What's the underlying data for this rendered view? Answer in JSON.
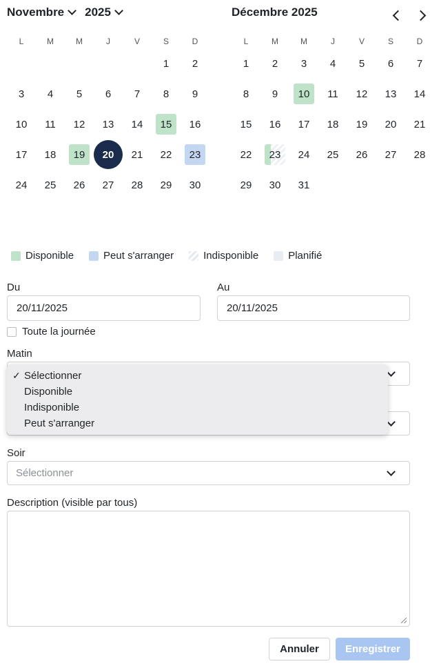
{
  "nav": {
    "left_month": "Novembre",
    "left_year": "2025",
    "right_title": "Décembre 2025"
  },
  "weekdays": [
    "L",
    "M",
    "M",
    "J",
    "V",
    "S",
    "D"
  ],
  "calendars": [
    {
      "name": "novembre",
      "rows": [
        [
          "",
          "",
          "",
          "",
          "",
          "1",
          "2"
        ],
        [
          "3",
          "4",
          "5",
          "6",
          "7",
          "8",
          "9"
        ],
        [
          "10",
          "11",
          "12",
          "13",
          "14",
          "15",
          "16"
        ],
        [
          "17",
          "18",
          "19",
          "20",
          "21",
          "22",
          "23"
        ],
        [
          "24",
          "25",
          "26",
          "27",
          "28",
          "29",
          "30"
        ]
      ],
      "marks": {
        "15": "dispo",
        "19": "dispo",
        "23": "arr"
      },
      "today": "20"
    },
    {
      "name": "decembre",
      "rows": [
        [
          "1",
          "2",
          "3",
          "4",
          "5",
          "6",
          "7"
        ],
        [
          "8",
          "9",
          "10",
          "11",
          "12",
          "13",
          "14"
        ],
        [
          "15",
          "16",
          "17",
          "18",
          "19",
          "20",
          "21"
        ],
        [
          "22",
          "23",
          "24",
          "25",
          "26",
          "27",
          "28"
        ],
        [
          "29",
          "30",
          "31",
          "",
          "",
          "",
          ""
        ]
      ],
      "marks": {
        "10": "dispo",
        "23": "split"
      },
      "today": ""
    }
  ],
  "legend": {
    "available": "Disponible",
    "maybe": "Peut s'arranger",
    "unavailable": "Indisponible",
    "planned": "Planifié"
  },
  "form": {
    "from_label": "Du",
    "from_value": "20/11/2025",
    "to_label": "Au",
    "to_value": "20/11/2025",
    "all_day_label": "Toute la journée",
    "morning_label": "Matin",
    "evening_label": "Soir",
    "evening_placeholder": "Sélectionner",
    "description_label": "Description (visible par tous)"
  },
  "dropdown": {
    "options": [
      "Sélectionner",
      "Disponible",
      "Indisponible",
      "Peut s'arranger"
    ],
    "selected": "Sélectionner"
  },
  "buttons": {
    "cancel": "Annuler",
    "save": "Enregistrer"
  }
}
